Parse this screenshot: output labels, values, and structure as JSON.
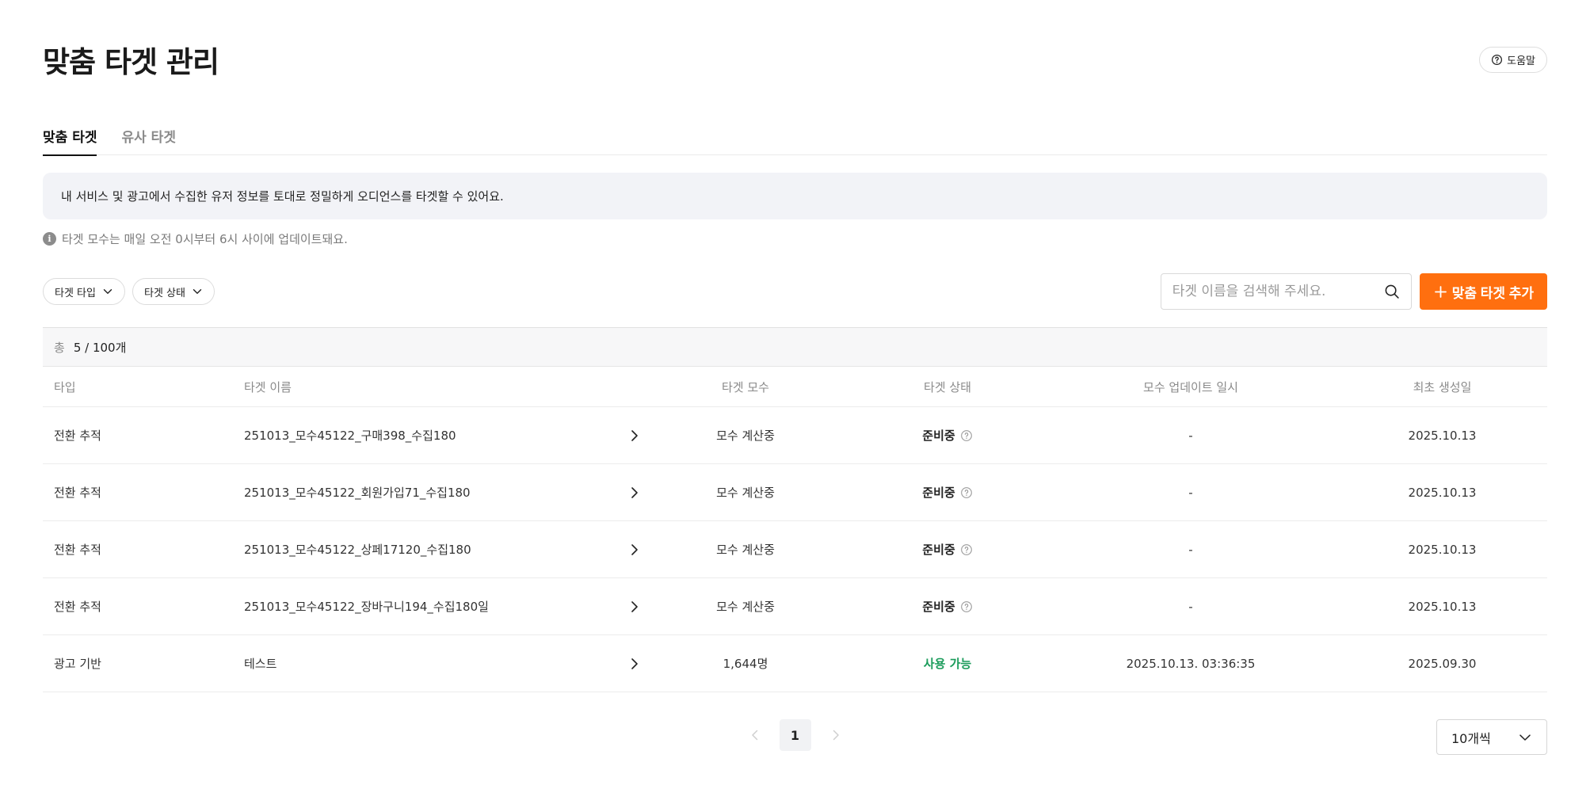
{
  "header": {
    "title": "맞춤 타겟 관리",
    "help_label": "도움말"
  },
  "tabs": [
    {
      "label": "맞춤 타겟",
      "active": true
    },
    {
      "label": "유사 타겟",
      "active": false
    }
  ],
  "notice": "내 서비스 및 광고에서 수집한 유저 정보를 토대로 정밀하게 오디언스를 타겟할 수 있어요.",
  "info_text": "타겟 모수는 매일 오전 0시부터 6시 사이에 업데이트돼요.",
  "filters": [
    {
      "label": "타겟 타입"
    },
    {
      "label": "타겟 상태"
    }
  ],
  "search": {
    "placeholder": "타겟 이름을 검색해 주세요.",
    "value": ""
  },
  "add_button_label": "맞춤 타겟 추가",
  "count": {
    "prefix": "총",
    "value": "5 / 100개"
  },
  "table": {
    "headers": [
      "타입",
      "타겟 이름",
      "타겟 모수",
      "타겟 상태",
      "모수 업데이트 일시",
      "최초 생성일"
    ],
    "rows": [
      {
        "type": "전환 추적",
        "name": "251013_모수45122_구매398_수집180",
        "size": "모수 계산중",
        "status": "준비중",
        "updated": "-",
        "created": "2025.10.13"
      },
      {
        "type": "전환 추적",
        "name": "251013_모수45122_회원가입71_수집180",
        "size": "모수 계산중",
        "status": "준비중",
        "updated": "-",
        "created": "2025.10.13"
      },
      {
        "type": "전환 추적",
        "name": "251013_모수45122_상페17120_수집180",
        "size": "모수 계산중",
        "status": "준비중",
        "updated": "-",
        "created": "2025.10.13"
      },
      {
        "type": "전환 추적",
        "name": "251013_모수45122_장바구니194_수집180일",
        "size": "모수 계산중",
        "status": "준비중",
        "updated": "-",
        "created": "2025.10.13"
      },
      {
        "type": "광고 기반",
        "name": "테스트",
        "size": "1,644명",
        "status": "사용 가능",
        "updated": "2025.10.13. 03:36:35",
        "created": "2025.09.30"
      }
    ]
  },
  "pagination": {
    "current": "1"
  },
  "page_size": "10개씩",
  "colors": {
    "accent": "#ff6f0f",
    "status_available": "#1a9b5a"
  },
  "icons": [
    "question-circle-icon",
    "info-icon",
    "chevron-down-icon",
    "search-icon",
    "plus-icon",
    "chevron-right-icon",
    "chevron-left-icon"
  ]
}
